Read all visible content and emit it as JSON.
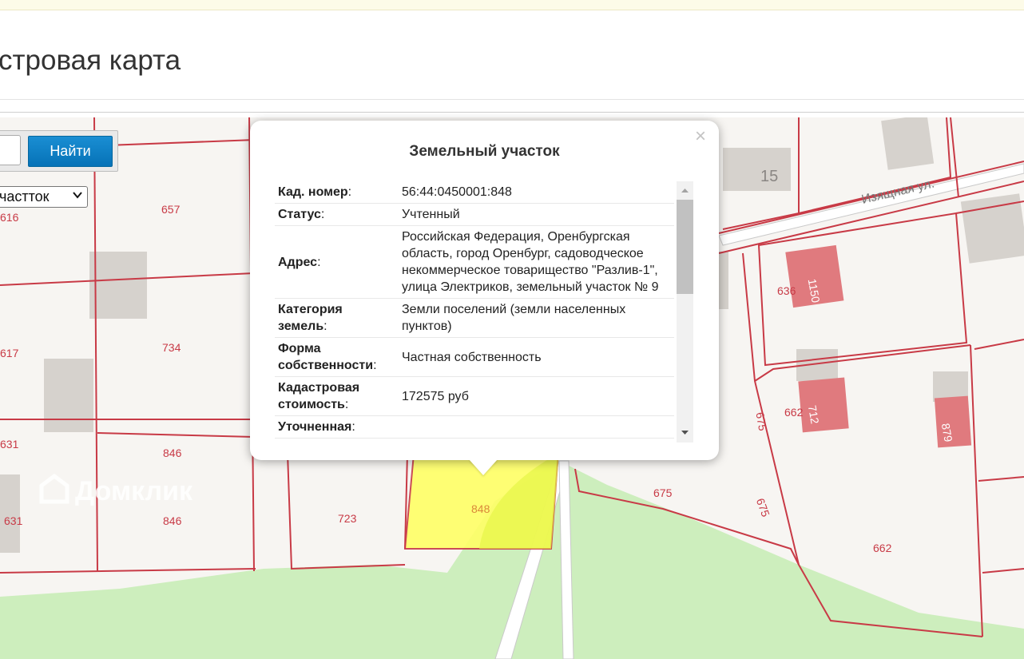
{
  "page": {
    "title": "стровая карта",
    "find_button": "Найти",
    "search_value": "",
    "object_type": "частток"
  },
  "map": {
    "parcel_labels": [
      "616",
      "657",
      "617",
      "734",
      "631",
      "846",
      "631",
      "846",
      "723",
      "848",
      "675",
      "662",
      "675",
      "675",
      "662",
      "636",
      "662"
    ],
    "building_labels": [
      "15",
      "1150",
      "712",
      "879"
    ],
    "street": "Изящная ул.",
    "watermark": "Домклик",
    "colors": {
      "boundary": "#c83a46",
      "selected_fill": "#ffff66",
      "green": "#cdeebd",
      "building": "#d6d2cd",
      "building_red": "#e07a7e"
    }
  },
  "popup": {
    "title": "Земельный участок",
    "close": "×",
    "rows": [
      {
        "label": "Кад. номер",
        "value": "56:44:0450001:848"
      },
      {
        "label": "Статус",
        "value": "Учтенный"
      },
      {
        "label": "Адрес",
        "value": "Российская Федерация, Оренбургская область, город Оренбург, садоводческое некоммерческое товарищество \"Разлив-1\", улица Электриков, земельный участок № 9"
      },
      {
        "label": "Категория земель",
        "value": "Земли поселений (земли населенных пунктов)"
      },
      {
        "label": "Форма собственности",
        "value": "Частная собственность"
      },
      {
        "label": "Кадастровая стоимость",
        "value": "172575 руб"
      },
      {
        "label": "Уточненная",
        "value": ""
      }
    ]
  }
}
